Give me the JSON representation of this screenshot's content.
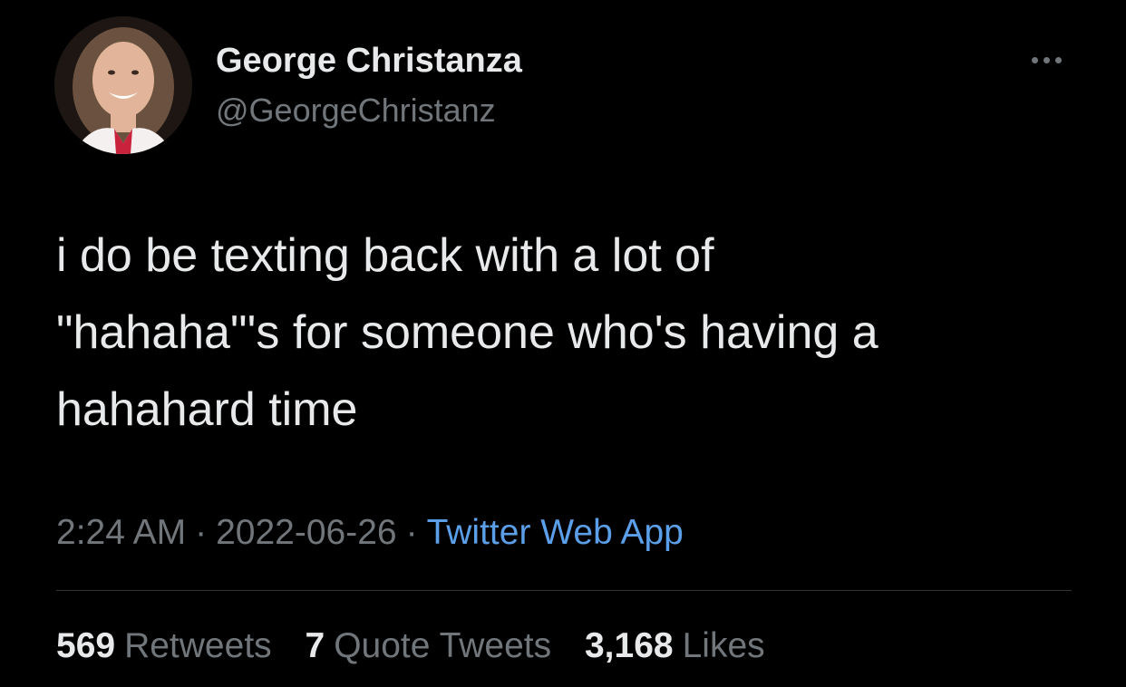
{
  "author": {
    "display_name": "George Christanza",
    "handle": "@GeorgeChristanz",
    "avatar_icon": "profile-photo"
  },
  "more_icon": "more-horizontal-icon",
  "tweet": {
    "text": "i do be texting back with a lot of\n\"hahaha\"'s for someone who's having a\nhahahard time"
  },
  "meta": {
    "time": "2:24 AM",
    "separator": "·",
    "date": "2022-06-26",
    "source": "Twitter Web App"
  },
  "stats": {
    "retweets_count": "569",
    "retweets_label": "Retweets",
    "quotes_count": "7",
    "quotes_label": "Quote Tweets",
    "likes_count": "3,168",
    "likes_label": "Likes"
  },
  "colors": {
    "background": "#000000",
    "primary_text": "#e7e9ea",
    "secondary_text": "#71767b",
    "link": "#5b9fe8",
    "divider": "#2f3336"
  }
}
